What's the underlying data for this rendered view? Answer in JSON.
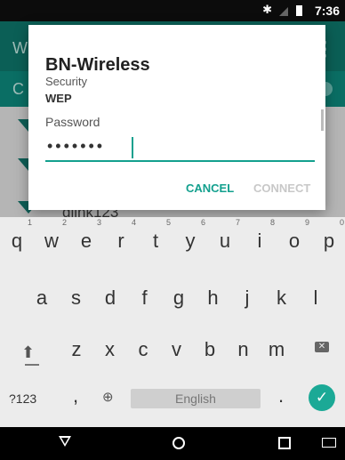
{
  "status_bar": {
    "time": "7:36",
    "bluetooth": "bluetooth-icon",
    "signal": "no-signal-icon",
    "battery": "battery-icon"
  },
  "background_app": {
    "toolbar_title": "W",
    "subbar_title": "C",
    "networks": [
      {
        "name": ""
      },
      {
        "name": ""
      },
      {
        "name": "dlink123"
      }
    ]
  },
  "dialog": {
    "title": "BN-Wireless",
    "security_label": "Security",
    "security_value": "WEP",
    "password_label": "Password",
    "password_value": "•••••••",
    "cancel_label": "CANCEL",
    "connect_label": "CONNECT",
    "accent": "#13a08e"
  },
  "keyboard": {
    "row1": [
      {
        "k": "q",
        "h": "1"
      },
      {
        "k": "w",
        "h": "2"
      },
      {
        "k": "e",
        "h": "3"
      },
      {
        "k": "r",
        "h": "4"
      },
      {
        "k": "t",
        "h": "5"
      },
      {
        "k": "y",
        "h": "6"
      },
      {
        "k": "u",
        "h": "7"
      },
      {
        "k": "i",
        "h": "8"
      },
      {
        "k": "o",
        "h": "9"
      },
      {
        "k": "p",
        "h": "0"
      }
    ],
    "row2": [
      "a",
      "s",
      "d",
      "f",
      "g",
      "h",
      "j",
      "k",
      "l"
    ],
    "row3": [
      "z",
      "x",
      "c",
      "v",
      "b",
      "n",
      "m"
    ],
    "symbols_label": "?123",
    "comma": ",",
    "space_label": "English",
    "period": ".",
    "enter_icon": "check-icon",
    "accent": "#1ba996"
  },
  "nav": {
    "back": "back-icon",
    "home": "home-icon",
    "recent": "recent-apps-icon",
    "keyboard": "keyboard-icon"
  }
}
